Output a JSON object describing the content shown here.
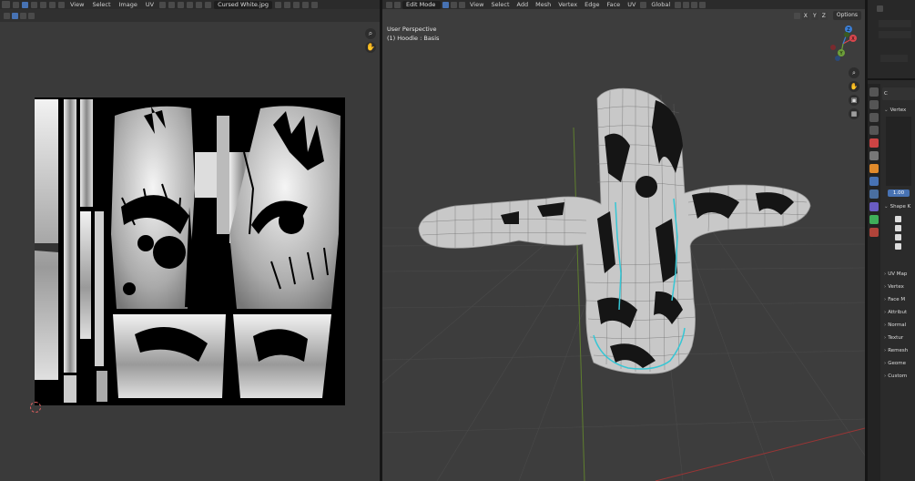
{
  "uv_editor": {
    "menus": [
      "View",
      "Select",
      "Image",
      "UV"
    ],
    "image_name": "Cursed White.jpg"
  },
  "viewport": {
    "mode": "Edit Mode",
    "menus": [
      "View",
      "Select",
      "Add",
      "Mesh",
      "Vertex",
      "Edge",
      "Face",
      "UV"
    ],
    "transform_orientation": "Global",
    "axes": [
      "X",
      "Y",
      "Z"
    ],
    "options_label": "Options",
    "view_label": "User Perspective",
    "object_label": "(1) Hoodie : Basis",
    "gizmo": {
      "x": "X",
      "y": "Y",
      "z": "Z"
    }
  },
  "properties": {
    "name_field": "C",
    "vertex_groups_title": "Vertex",
    "vertex_value": "1.00",
    "shape_keys_title": "Shape K",
    "collapsed_panels": [
      "UV Map",
      "Vertex",
      "Face M",
      "Attribut",
      "Normal",
      "Textur",
      "Remesh",
      "Geome",
      "Custom"
    ]
  },
  "colors": {
    "accent": "#4772b3",
    "wire_select": "#36c6d4",
    "axis_red": "#d9464d",
    "axis_green": "#6d9f3a",
    "axis_blue": "#3b7fd6"
  },
  "icons": [
    "image-icon",
    "zoom-icon",
    "hand-icon",
    "camera-icon",
    "grid-icon",
    "uv-cursor-icon"
  ]
}
